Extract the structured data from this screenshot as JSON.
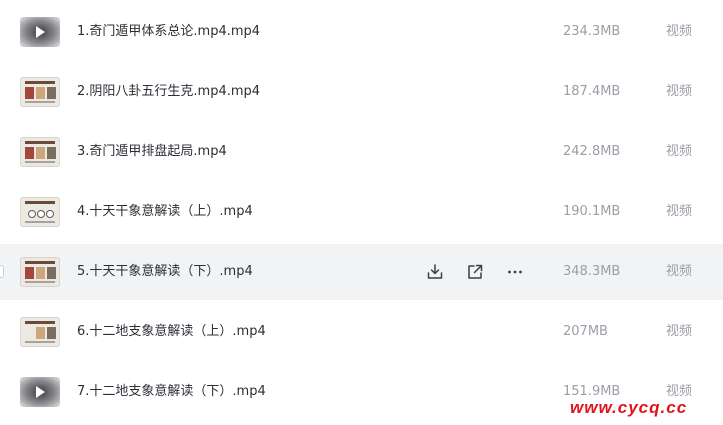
{
  "files": [
    {
      "name": "1.奇门遁甲体系总论.mp4.mp4",
      "size": "234.3MB",
      "type": "视频",
      "thumbnail": "video-dark"
    },
    {
      "name": "2.阴阳八卦五行生克.mp4.mp4",
      "size": "187.4MB",
      "type": "视频",
      "thumbnail": "slide"
    },
    {
      "name": "3.奇门遁甲排盘起局.mp4",
      "size": "242.8MB",
      "type": "视频",
      "thumbnail": "slide"
    },
    {
      "name": "4.十天干象意解读（上）.mp4",
      "size": "190.1MB",
      "type": "视频",
      "thumbnail": "diagram"
    },
    {
      "name": "5.十天干象意解读（下）.mp4",
      "size": "348.3MB",
      "type": "视频",
      "thumbnail": "slide",
      "hovered": true
    },
    {
      "name": "6.十二地支象意解读（上）.mp4",
      "size": "207MB",
      "type": "视频",
      "thumbnail": "slide"
    },
    {
      "name": "7.十二地支象意解读（下）.mp4",
      "size": "151.9MB",
      "type": "视频",
      "thumbnail": "video-dark"
    }
  ],
  "row_actions": {
    "download_icon": "download-icon",
    "share_icon": "share-icon",
    "more_icon": "more-icon"
  },
  "watermark": "www.cycq.cc",
  "colors": {
    "hover_row": "#f2f3f5",
    "text_primary": "#2b2f36",
    "text_secondary": "#9a9ea6",
    "watermark": "#e0141e"
  }
}
